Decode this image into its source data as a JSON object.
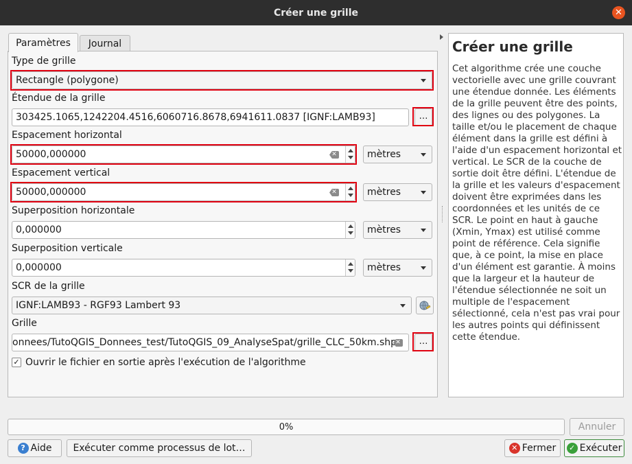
{
  "window": {
    "title": "Créer une grille",
    "close_glyph": "✕"
  },
  "tabs": [
    {
      "label": "Paramètres",
      "active": true
    },
    {
      "label": "Journal",
      "active": false
    }
  ],
  "params": {
    "grid_type": {
      "label": "Type de grille",
      "value": "Rectangle (polygone)"
    },
    "extent": {
      "label": "Étendue de la grille",
      "value": "303425.1065,1242204.4516,6060716.8678,6941611.0837 [IGNF:LAMB93]",
      "button": "…"
    },
    "h_spacing": {
      "label": "Espacement horizontal",
      "value": "50000,000000",
      "unit": "mètres"
    },
    "v_spacing": {
      "label": "Espacement vertical",
      "value": "50000,000000",
      "unit": "mètres"
    },
    "h_overlay": {
      "label": "Superposition horizontale",
      "value": "0,000000",
      "unit": "mètres"
    },
    "v_overlay": {
      "label": "Superposition verticale",
      "value": "0,000000",
      "unit": "mètres"
    },
    "crs": {
      "label": "SCR de la grille",
      "value": "IGNF:LAMB93 - RGF93 Lambert 93"
    },
    "output": {
      "label": "Grille",
      "value": "onnees/TutoQGIS_Donnees_test/TutoQGIS_09_AnalyseSpat/grille_CLC_50km.shp",
      "button": "…"
    },
    "open_after": {
      "label": "Ouvrir le fichier en sortie après l'exécution de l'algorithme",
      "checked": true,
      "check_glyph": "✓"
    }
  },
  "help": {
    "title": "Créer une grille",
    "text": "Cet algorithme crée une couche vectorielle avec une grille couvrant une étendue donnée. Les éléments de la grille peuvent être des points, des lignes ou des polygones. La taille et/ou le placement de chaque élément dans la grille est défini à l'aide d'un espacement horizontal et vertical. Le SCR de la couche de sortie doit être défini. L'étendue de la grille et les valeurs d'espacement doivent être exprimées dans les coordonnées et les unités de ce SCR. Le point en haut à gauche (Xmin, Ymax) est utilisé comme point de référence. Cela signifie que, à ce point, la mise en place d'un élément est garantie. À moins que la largeur et la hauteur de l'étendue sélectionnée ne soit un multiple de l'espacement sélectionné, cela n'est pas vrai pour les autres points qui définissent cette étendue."
  },
  "progress": {
    "value": 0,
    "text": "0%"
  },
  "buttons": {
    "cancel": "Annuler",
    "help": "Aide",
    "batch": "Exécuter comme processus de lot…",
    "close": "Fermer",
    "run": "Exécuter"
  },
  "colors": {
    "highlight": "#e00010",
    "titlebar": "#2e2e2e",
    "close_button": "#e95420",
    "help_icon": "#3a7fd0",
    "close_icon": "#d9342b",
    "run_icon": "#3aa03a"
  }
}
